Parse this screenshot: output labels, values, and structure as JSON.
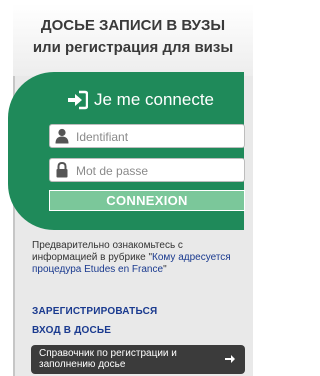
{
  "header": {
    "title_line1": "ДОСЬЕ ЗАПИСИ В ВУЗЫ",
    "title_line2": "или регистрация для визы"
  },
  "login": {
    "heading": "Je me connecte",
    "username_placeholder": "Identifiant",
    "password_placeholder": "Mot de passe",
    "submit_label": "CONNEXION"
  },
  "info": {
    "text_before": "Предварительно ознакомьтесь с информацией в рубрике \"",
    "link_text": "Кому адресуется процедура Etudes en France",
    "text_after": "\""
  },
  "links": {
    "register": "ЗАРЕГИСТРИРОВАТЬСЯ",
    "login": "ВХОД В ДОСЬЕ"
  },
  "guide": {
    "label": "Справочник по регистрации и заполнению досье"
  },
  "colors": {
    "green": "#1f8a5a",
    "button": "#7bc79a",
    "link": "#1a3a8f",
    "guide_bg": "#3b3b3b"
  }
}
